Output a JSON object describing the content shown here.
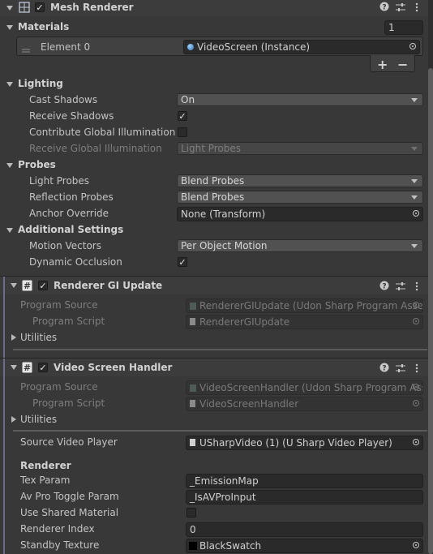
{
  "mesh_renderer": {
    "title": "Mesh Renderer",
    "enabled": true,
    "materials": {
      "label": "Materials",
      "count": "1",
      "element_label": "Element 0",
      "element_value": "VideoScreen (Instance)",
      "add_label": "+",
      "remove_label": "−"
    },
    "lighting": {
      "label": "Lighting",
      "cast_shadows": {
        "label": "Cast Shadows",
        "value": "On"
      },
      "receive_shadows": {
        "label": "Receive Shadows",
        "checked": true
      },
      "contribute_gi": {
        "label": "Contribute Global Illumination",
        "checked": false
      },
      "receive_gi": {
        "label": "Receive Global Illumination",
        "value": "Light Probes"
      }
    },
    "probes": {
      "label": "Probes",
      "light_probes": {
        "label": "Light Probes",
        "value": "Blend Probes"
      },
      "reflection_probes": {
        "label": "Reflection Probes",
        "value": "Blend Probes"
      },
      "anchor_override": {
        "label": "Anchor Override",
        "value": "None (Transform)"
      }
    },
    "additional": {
      "label": "Additional Settings",
      "motion_vectors": {
        "label": "Motion Vectors",
        "value": "Per Object Motion"
      },
      "dynamic_occlusion": {
        "label": "Dynamic Occlusion",
        "checked": true
      }
    }
  },
  "renderer_gi_update": {
    "title": "Renderer GI Update",
    "enabled": true,
    "program_source": {
      "label": "Program Source",
      "value": "RendererGIUpdate (Udon Sharp Program Asset)"
    },
    "program_script": {
      "label": "Program Script",
      "value": "RendererGIUpdate"
    },
    "utilities_label": "Utilities"
  },
  "video_screen_handler": {
    "title": "Video Screen Handler",
    "enabled": true,
    "program_source": {
      "label": "Program Source",
      "value": "VideoScreenHandler (Udon Sharp Program Asset)"
    },
    "program_script": {
      "label": "Program Script",
      "value": "VideoScreenHandler"
    },
    "utilities_label": "Utilities",
    "source_video_player": {
      "label": "Source Video Player",
      "value": "USharpVideo (1) (U Sharp Video Player)"
    },
    "renderer_header": "Renderer",
    "tex_param": {
      "label": "Tex Param",
      "value": "_EmissionMap"
    },
    "avpro_toggle_param": {
      "label": "Av Pro Toggle Param",
      "value": "_IsAVProInput"
    },
    "use_shared_material": {
      "label": "Use Shared Material",
      "checked": false
    },
    "renderer_index": {
      "label": "Renderer Index",
      "value": "0"
    },
    "standby_texture": {
      "label": "Standby Texture",
      "value": "BlackSwatch"
    }
  },
  "colors": {
    "background": "#383838",
    "header": "#3c3c3c",
    "field": "#2a2a2a",
    "dropdown": "#515151",
    "component_accent": "#6c6c8a"
  }
}
